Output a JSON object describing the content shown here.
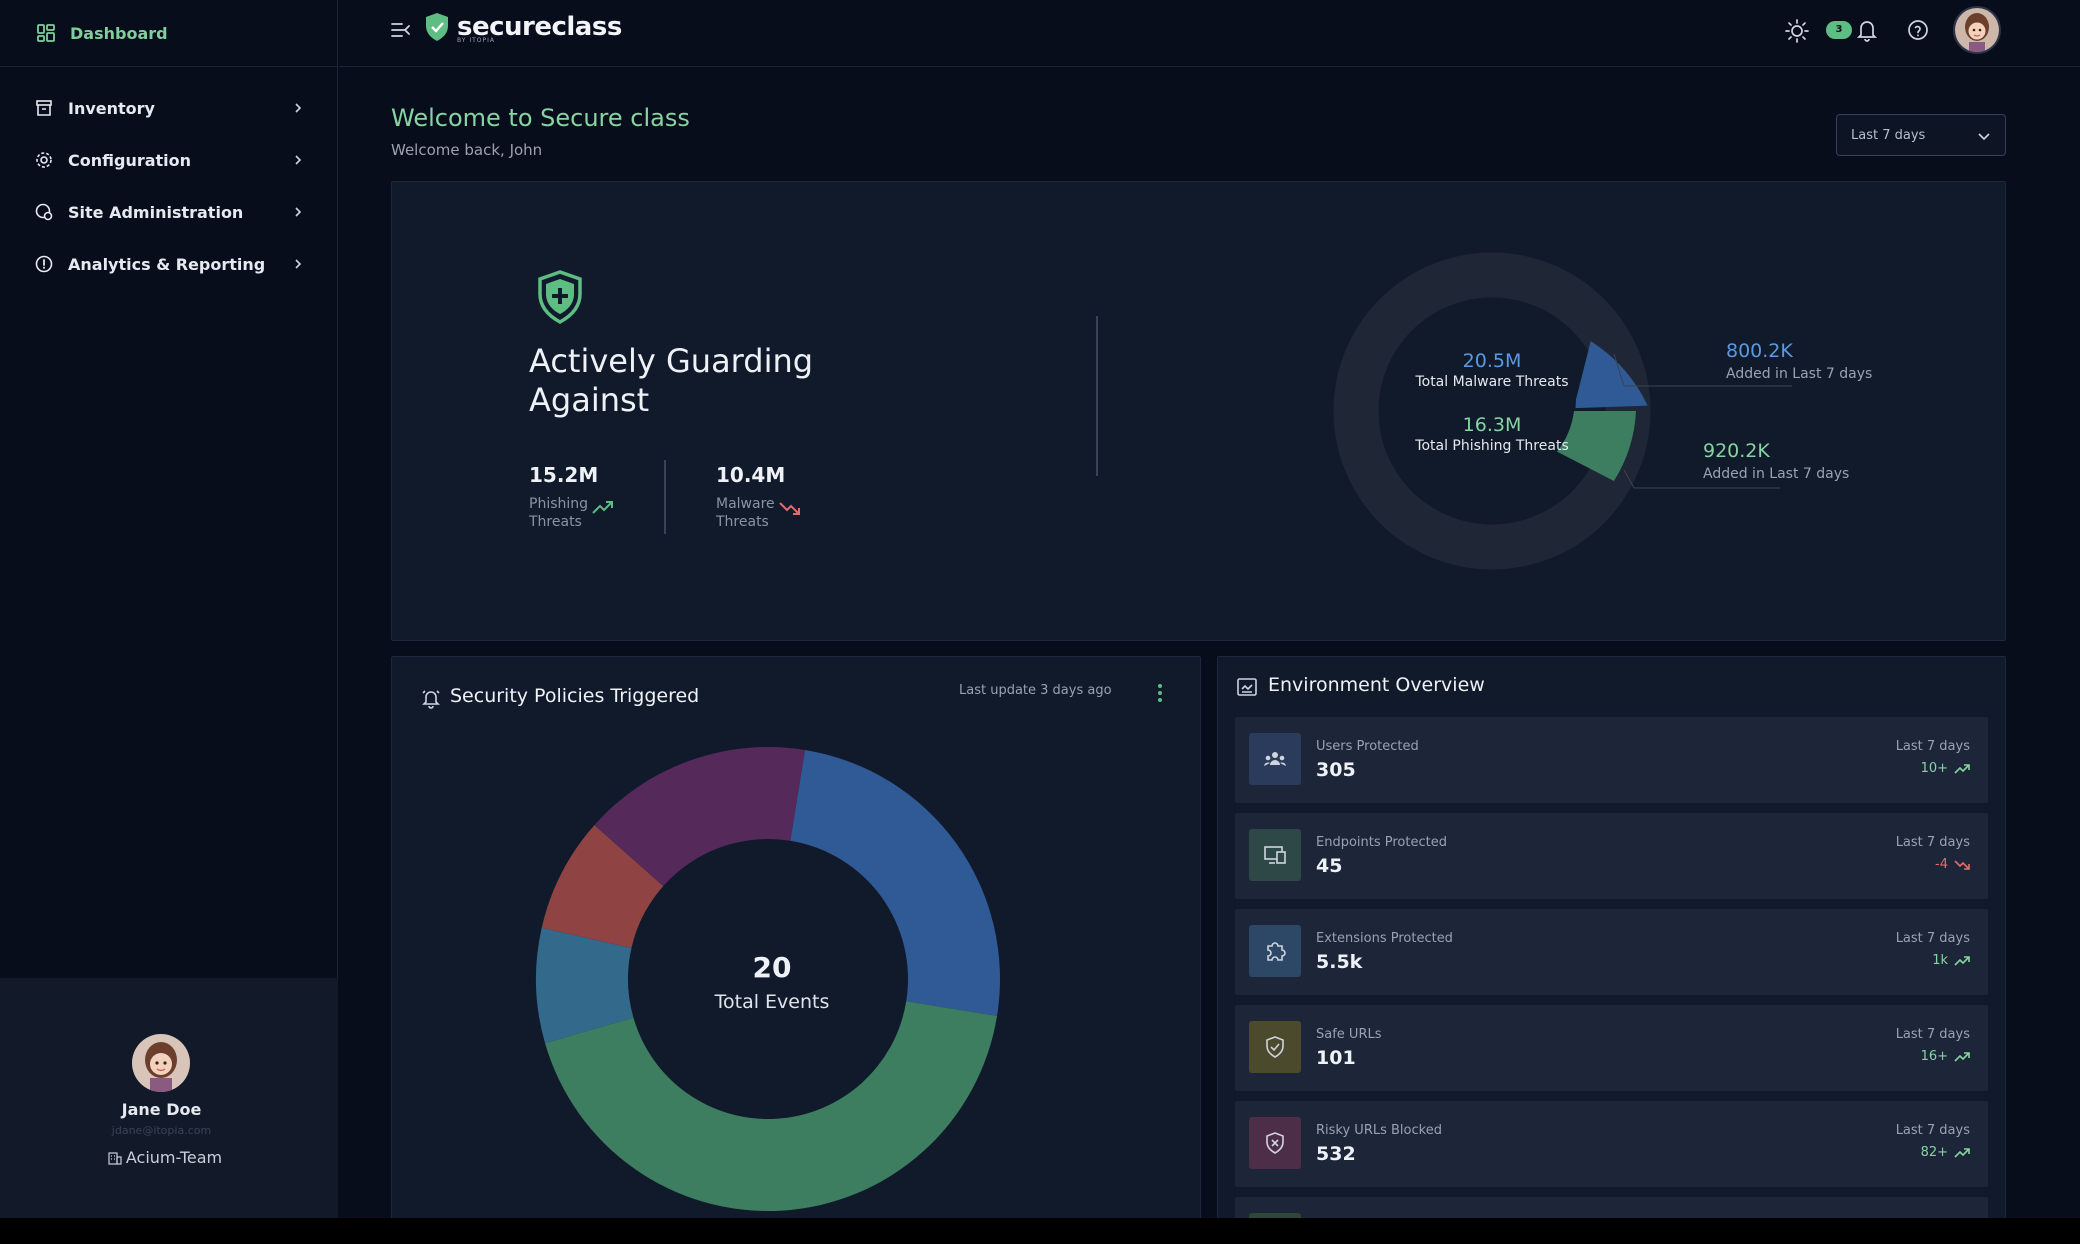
{
  "sidebar": {
    "dashboard_label": "Dashboard",
    "items": [
      {
        "label": "Inventory",
        "icon": "inventory-icon"
      },
      {
        "label": "Configuration",
        "icon": "gear-icon"
      },
      {
        "label": "Site Administration",
        "icon": "site-admin-icon"
      },
      {
        "label": "Analytics & Reporting",
        "icon": "analytics-icon"
      }
    ],
    "profile": {
      "name": "Jane Doe",
      "email": "jdane@itopia.com",
      "team": "Acium-Team"
    }
  },
  "header": {
    "brand": "secureclass",
    "brand_sub": "BY ITOPIA",
    "notification_count": "3"
  },
  "main": {
    "welcome_title": "Welcome to Secure class",
    "welcome_sub": "Welcome back, John",
    "range": "Last 7 days"
  },
  "hero": {
    "title": "Actively Guarding Against",
    "phishing_value": "15.2M",
    "phishing_label": "Phishing Threats",
    "malware_value": "10.4M",
    "malware_label": "Malware Threats",
    "ring": {
      "malware_total": "20.5M",
      "malware_total_label": "Total Malware Threats",
      "phishing_total": "16.3M",
      "phishing_total_label": "Total Phishing Threats",
      "malware_added": "800.2K",
      "malware_added_label": "Added in Last 7 days",
      "phishing_added": "920.2K",
      "phishing_added_label": "Added in Last 7 days"
    }
  },
  "policies": {
    "title": "Security Policies Triggered",
    "last_update": "Last update 3 days ago",
    "total_value": "20",
    "total_label": "Total Events"
  },
  "environment": {
    "title": "Environment Overview",
    "rows": [
      {
        "label": "Users Protected",
        "value": "305",
        "period": "Last 7 days",
        "delta": "10+",
        "trend": "up"
      },
      {
        "label": "Endpoints Protected",
        "value": "45",
        "period": "Last 7 days",
        "delta": "-4",
        "trend": "down"
      },
      {
        "label": "Extensions Protected",
        "value": "5.5k",
        "period": "Last 7 days",
        "delta": "1k",
        "trend": "up"
      },
      {
        "label": "Safe URLs",
        "value": "101",
        "period": "Last 7 days",
        "delta": "16+",
        "trend": "up"
      },
      {
        "label": "Risky URLs Blocked",
        "value": "532",
        "period": "Last 7 days",
        "delta": "82+",
        "trend": "up"
      }
    ]
  },
  "colors": {
    "accent_green": "#5ebd83",
    "blue": "#2f5a96",
    "purple": "#55295a",
    "red": "#8f4343",
    "teal": "#336a8c",
    "green": "#3d7d60",
    "danger": "#e56b6b"
  },
  "chart_data": {
    "type": "pie",
    "values": [
      25,
      43,
      8,
      8,
      16
    ],
    "colors": [
      "#2f5a96",
      "#3d7d60",
      "#336a8c",
      "#8f4343",
      "#55295a"
    ]
  }
}
